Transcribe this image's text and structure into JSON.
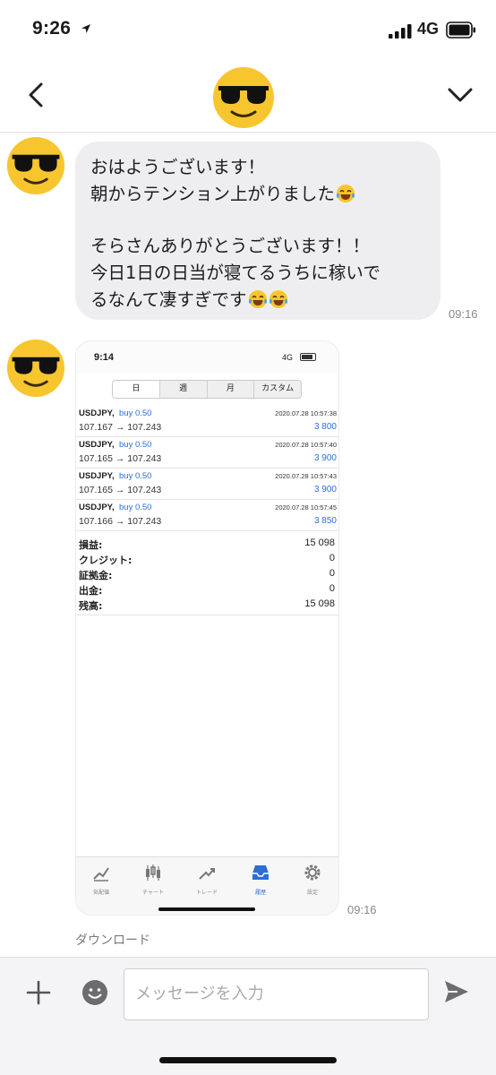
{
  "status_bar": {
    "time": "9:26",
    "network": "4G"
  },
  "header": {
    "back_icon": "chevron-left-icon",
    "avatar": "sunglasses-emoji",
    "menu_icon": "chevron-down-icon"
  },
  "messages": [
    {
      "type": "text",
      "lines": [
        "おはようございます！",
        "朝からテンション上がりました",
        "",
        "そらさんありがとうございます！！",
        "今日1日の日当が寝てるうちに稼いで",
        "るなんて凄すぎです"
      ],
      "time": "09:16"
    },
    {
      "type": "image",
      "time": "09:16",
      "screenshot": {
        "status_time": "9:14",
        "network": "4G",
        "segments": [
          "日",
          "週",
          "月",
          "カスタム"
        ],
        "active_segment": "日",
        "trades": [
          {
            "symbol": "USDJPY,",
            "side": "buy 0.50",
            "datetime": "2020.07.28 10:57:38",
            "prices": "107.167 → 107.243",
            "profit": "3 800"
          },
          {
            "symbol": "USDJPY,",
            "side": "buy 0.50",
            "datetime": "2020.07.28 10:57:40",
            "prices": "107.165 → 107.243",
            "profit": "3 900"
          },
          {
            "symbol": "USDJPY,",
            "side": "buy 0.50",
            "datetime": "2020.07.28 10:57:43",
            "prices": "107.165 → 107.243",
            "profit": "3 900"
          },
          {
            "symbol": "USDJPY,",
            "side": "buy 0.50",
            "datetime": "2020.07.28 10:57:45",
            "prices": "107.166 → 107.243",
            "profit": "3 850"
          }
        ],
        "summary": [
          {
            "label": "損益:",
            "value": "15 098"
          },
          {
            "label": "クレジット:",
            "value": "0"
          },
          {
            "label": "証拠金:",
            "value": "0"
          },
          {
            "label": "出金:",
            "value": "0"
          },
          {
            "label": "残高:",
            "value": "15 098"
          }
        ],
        "tabs": [
          {
            "label": "気配値",
            "icon": "quotes-icon"
          },
          {
            "label": "チャート",
            "icon": "candles-icon"
          },
          {
            "label": "トレード",
            "icon": "trade-icon"
          },
          {
            "label": "履歴",
            "icon": "history-icon",
            "active": true
          },
          {
            "label": "設定",
            "icon": "settings-icon"
          }
        ]
      }
    }
  ],
  "download_label": "ダウンロード",
  "input": {
    "placeholder": "メッセージを入力"
  },
  "colors": {
    "bubble": "#eeeef0",
    "accent": "#2b6fd6",
    "emoji_yellow": "#f7c52e"
  }
}
